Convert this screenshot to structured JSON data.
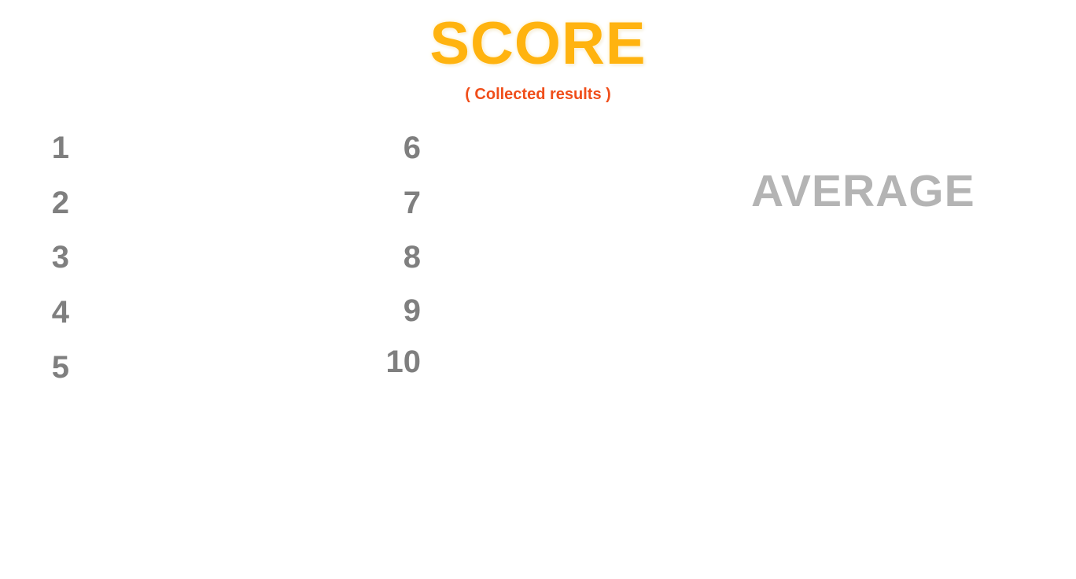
{
  "header": {
    "title": "SCORE",
    "subtitle": "( Collected results )"
  },
  "slots": {
    "left": [
      "1",
      "2",
      "3",
      "4",
      "5"
    ],
    "right": [
      "6",
      "7",
      "8",
      "9",
      "10"
    ]
  },
  "average": {
    "label": "AVERAGE"
  },
  "colors": {
    "title": "#FFB30F",
    "subtitle": "#F04E1A",
    "slot_number": "#7F7F7F",
    "average_label": "#B4B4B4",
    "background": "#FFFFFF"
  }
}
